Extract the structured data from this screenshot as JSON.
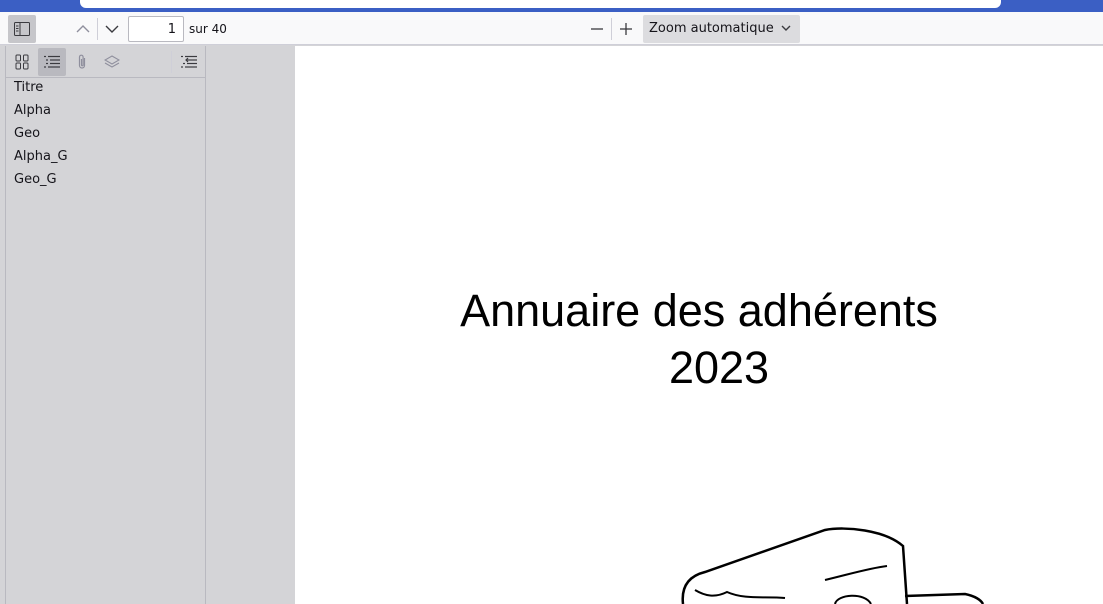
{
  "toolbar": {
    "page_number": "1",
    "page_count": "sur 40",
    "zoom": "Zoom automatique",
    "icons": {
      "sidebar_toggle": "sidebar-toggle-icon",
      "previous_page": "chevron-up-icon",
      "next_page": "chevron-down-icon",
      "zoom_out": "minus-icon",
      "zoom_in": "plus-icon",
      "zoom_dropdown": "chevron-down-icon"
    }
  },
  "sidebar": {
    "views": [
      "thumbnails",
      "outline",
      "attachments",
      "layers"
    ],
    "active_view": "outline",
    "outline_items": [
      "Titre",
      "Alpha",
      "Geo",
      "Alpha_G",
      "Geo_G"
    ]
  },
  "document": {
    "title_line1": "Annuaire des adhérents",
    "title_line2": "2023"
  },
  "colors": {
    "browser_chrome": "#3b5fc4",
    "toolbar_bg": "#f9f9fa",
    "sidebar_bg": "#d4d4d7",
    "page_bg": "#ffffff",
    "active_button": "#c6c6ca"
  }
}
